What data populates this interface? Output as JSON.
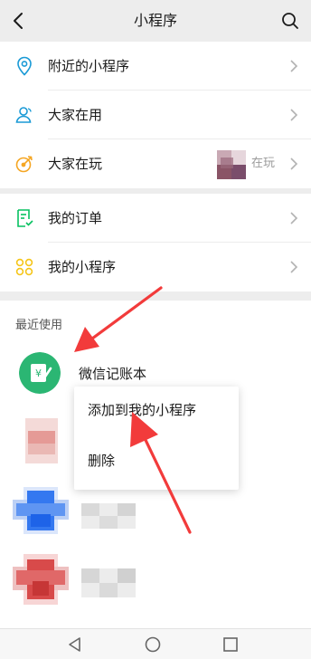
{
  "header": {
    "title": "小程序"
  },
  "menu_top": [
    {
      "label": "附近的小程序"
    },
    {
      "label": "大家在用"
    },
    {
      "label": "大家在玩",
      "extra": "在玩"
    }
  ],
  "menu_mid": [
    {
      "label": "我的订单"
    },
    {
      "label": "我的小程序"
    }
  ],
  "recent": {
    "section_label": "最近使用",
    "first_app": {
      "name": "微信记账本"
    }
  },
  "popup": {
    "add_label": "添加到我的小程序",
    "delete_label": "删除"
  },
  "colors": {
    "accent_green": "#07c160",
    "arrow_red": "#f23b3b",
    "icon_blue": "#1a9ad6",
    "icon_orange": "#f5a623",
    "icon_yellow": "#f5c518"
  }
}
